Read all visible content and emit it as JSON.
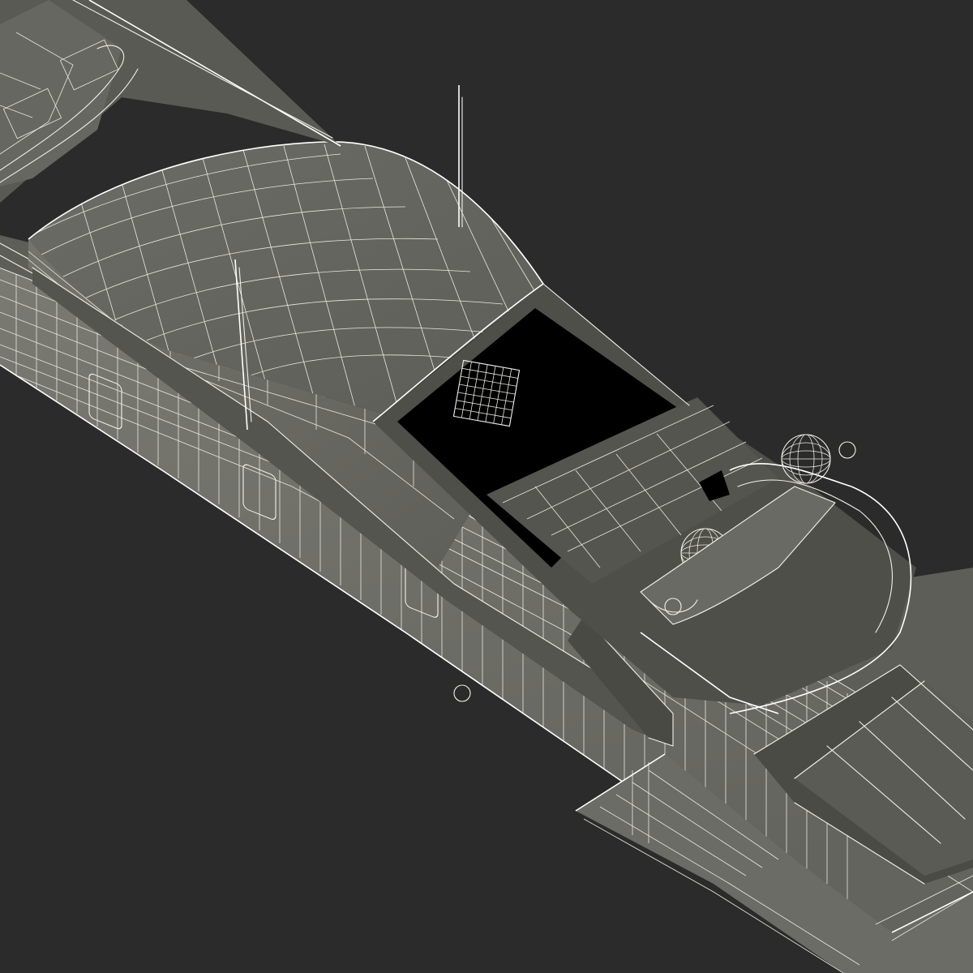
{
  "scene": {
    "subject": "yacht-wireframe-render",
    "background_color": "#2b2b2b",
    "hull_side_color": "#6e6e68",
    "hull_deck_color": "#61615b",
    "deck_dark_color": "#4c4c47",
    "recess_color": "#3a3a36",
    "wire_color": "#f2f1e6"
  }
}
